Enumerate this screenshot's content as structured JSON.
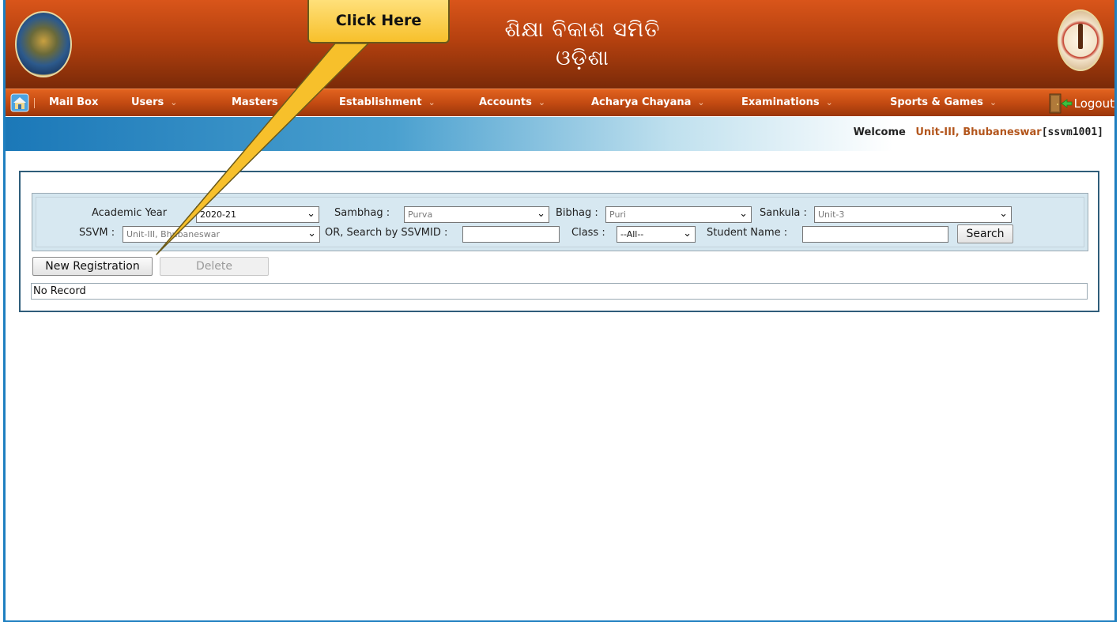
{
  "header": {
    "title_line1": "ଶିକ୍ଷା ବିକାଶ ସମିତି",
    "title_line2": "ଓଡ଼ିଶା",
    "colors": {
      "banner": "#b5410f",
      "nav": "#c44b12",
      "accent": "#1e7fc0"
    }
  },
  "nav": {
    "items": [
      {
        "label": "Mail Box",
        "dropdown": false
      },
      {
        "label": "Users",
        "dropdown": true
      },
      {
        "label": "Masters",
        "dropdown": false
      },
      {
        "label": "Establishment",
        "dropdown": true
      },
      {
        "label": "Accounts",
        "dropdown": true
      },
      {
        "label": "Acharya Chayana",
        "dropdown": true
      },
      {
        "label": "Examinations",
        "dropdown": true
      },
      {
        "label": "Sports & Games",
        "dropdown": true
      }
    ],
    "logout_label": "Logout",
    "icons": {
      "home": "home-icon",
      "logout": "logout-door-icon",
      "dropdown": "chevron-down-icon"
    }
  },
  "welcome": {
    "label": "Welcome",
    "unit": "Unit-III, Bhubaneswar",
    "code": "[ssvm1001]"
  },
  "filters": {
    "academic_year_label": "Academic Year",
    "academic_year_value": "2020-21",
    "sambhag_label": "Sambhag :",
    "sambhag_value": "Purva",
    "bibhag_label": "Bibhag :",
    "bibhag_value": "Puri",
    "sankula_label": "Sankula :",
    "sankula_value": "Unit-3",
    "ssvm_label": "SSVM :",
    "ssvm_value": "Unit-III, Bhubaneswar",
    "search_ssvmid_label": "OR, Search by SSVMID :",
    "ssvmid_value": "",
    "class_label": "Class :",
    "class_value": "--All--",
    "student_name_label": "Student Name :",
    "student_name_value": "",
    "search_button": "Search"
  },
  "actions": {
    "new_registration": "New Registration",
    "delete": "Delete"
  },
  "results": {
    "empty_text": "No Record"
  },
  "annotation": {
    "callout_text": "Click Here"
  }
}
